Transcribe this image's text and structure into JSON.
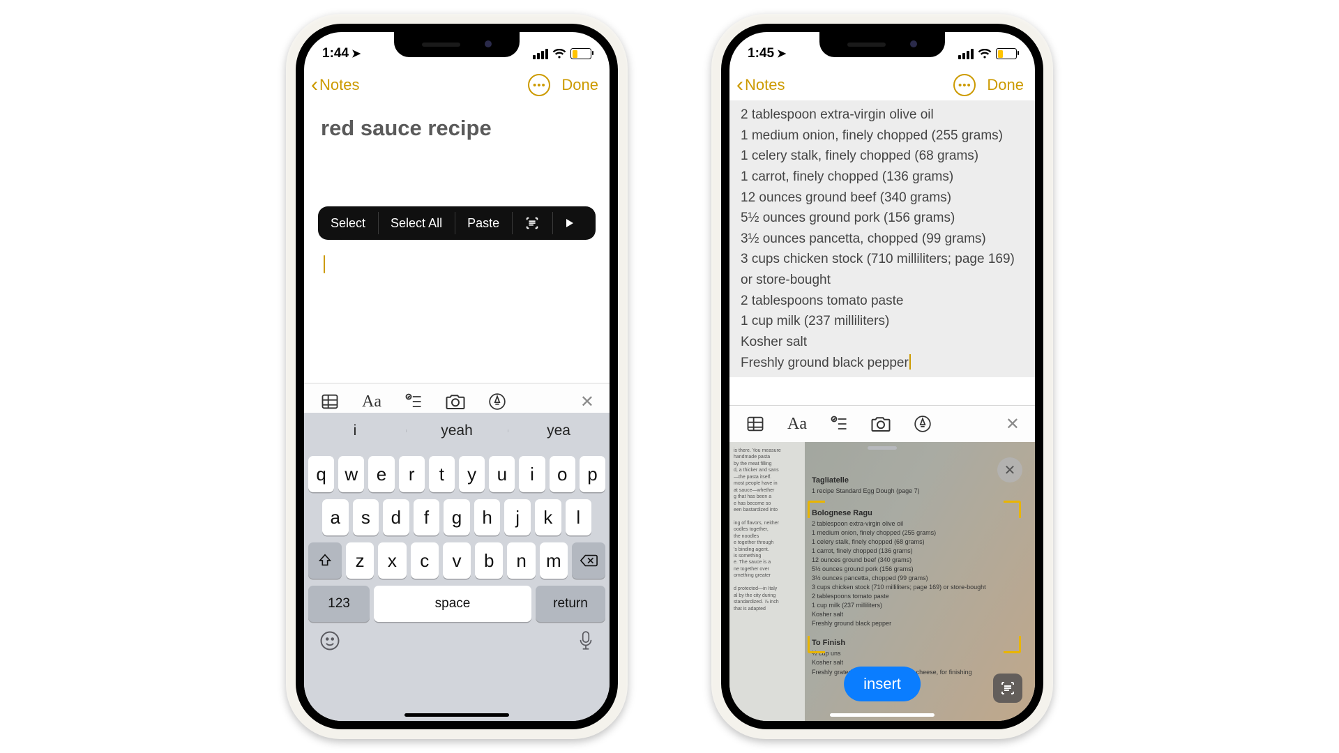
{
  "phone1": {
    "status": {
      "time": "1:44"
    },
    "nav": {
      "back": "Notes",
      "done": "Done"
    },
    "title": "red sauce recipe",
    "popup": {
      "select": "Select",
      "select_all": "Select All",
      "paste": "Paste"
    },
    "suggestions": [
      "i",
      "yeah",
      "yea"
    ],
    "keys_row1": [
      "q",
      "w",
      "e",
      "r",
      "t",
      "y",
      "u",
      "i",
      "o",
      "p"
    ],
    "keys_row2": [
      "a",
      "s",
      "d",
      "f",
      "g",
      "h",
      "j",
      "k",
      "l"
    ],
    "keys_row3": [
      "z",
      "x",
      "c",
      "v",
      "b",
      "n",
      "m"
    ],
    "num_key": "123",
    "space_key": "space",
    "return_key": "return"
  },
  "phone2": {
    "status": {
      "time": "1:45"
    },
    "nav": {
      "back": "Notes",
      "done": "Done"
    },
    "ingredients": [
      "2 tablespoon extra-virgin olive oil",
      "1 medium onion, finely chopped (255 grams)",
      "1 celery stalk, finely chopped (68 grams)",
      "1 carrot, finely chopped (136 grams)",
      "12 ounces ground beef (340 grams)",
      "5½ ounces ground pork (156 grams)",
      "3½ ounces pancetta, chopped (99 grams)",
      "3 cups chicken stock (710 milliliters; page 169) or store-bought",
      "2 tablespoons tomato paste",
      "1 cup milk (237 milliliters)",
      "Kosher salt",
      "Freshly ground black pepper"
    ],
    "camera": {
      "insert": "insert",
      "page_left": "is there. You measure\nhandmade pasta\nby the meat filling\nd, a thicker and sans\n—the pasta itself.\nmost people have in\nat sauce—whether\ng that has been a\ne has become so\neen bastardized into\n\ning of flavors, neither\noodles together,\nthe noodles\ne together through\n's binding agent.\nis something\ne. The sauce is a\nne together over\nomething greater\n\nd protected—in Italy\nal by the city during\nstandardized. ⅞ inch\nthat is adapted",
      "tagliatelle_title": "Tagliatelle",
      "tagliatelle_sub": "1 recipe Standard Egg Dough  (page 7)",
      "bolognese_title": "Bolognese Ragu",
      "bolognese_lines": [
        "2 tablespoon extra-virgin olive oil",
        "1 medium onion, finely chopped (255 grams)",
        "1 celery stalk, finely chopped (68 grams)",
        "1 carrot, finely chopped (136 grams)",
        "12 ounces ground beef (340 grams)",
        "5½ ounces ground pork (156 grams)",
        "3½ ounces pancetta, chopped (99 grams)",
        "3 cups chicken stock (710 milliliters; page 169) or store-bought",
        "2 tablespoons tomato paste",
        "1 cup milk (237 milliliters)",
        "Kosher salt",
        "Freshly ground black pepper"
      ],
      "to_finish_title": "To Finish",
      "to_finish_lines": [
        "½ cup uns",
        "Kosher salt",
        "Freshly grated Parmigiano-Reggiano cheese, for finishing"
      ]
    }
  }
}
